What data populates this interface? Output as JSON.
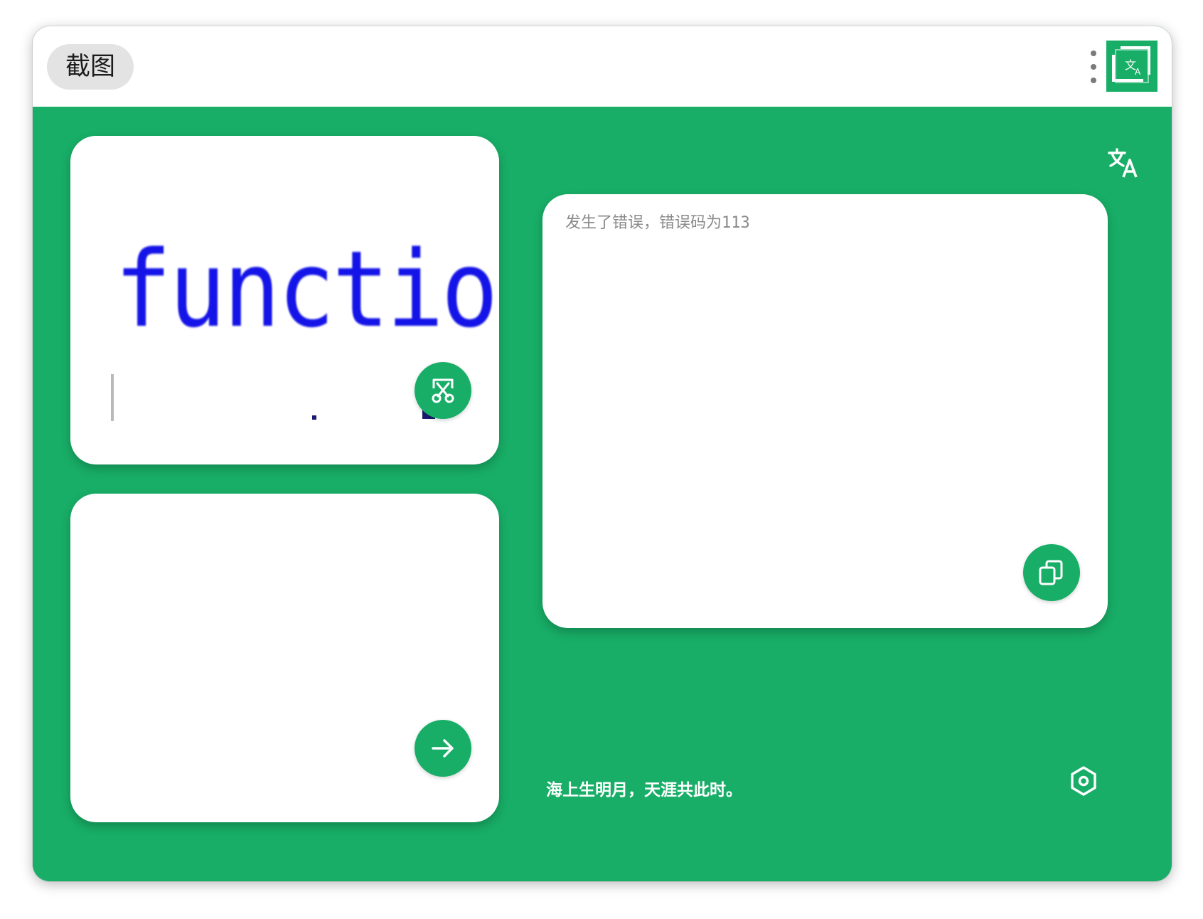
{
  "titlebar": {
    "capture_label": "截图"
  },
  "icons": {
    "menu": "more-vertical-icon",
    "logo": "translate-crop-logo-icon",
    "translate": "translate-icon",
    "scissors": "screenshot-scissors-icon",
    "arrow": "arrow-right-icon",
    "copy": "copy-icon",
    "settings": "settings-hexagon-icon"
  },
  "preview": {
    "text": "function"
  },
  "output": {
    "text": "发生了错误，错误码为113"
  },
  "footer": {
    "poem": "海上生明月，天涯共此时。"
  },
  "colors": {
    "accent": "#18ae67",
    "card": "#ffffff",
    "preview_text": "#1414e8",
    "output_text": "#8a8a8a"
  }
}
